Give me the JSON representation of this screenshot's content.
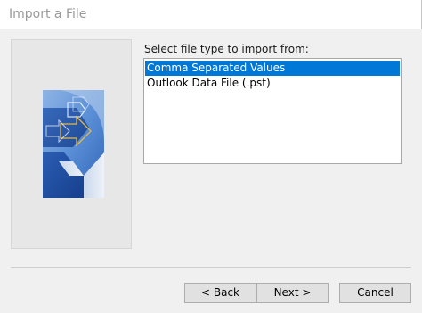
{
  "window": {
    "title": "Import a File"
  },
  "art": {
    "icon": "import-wizard-illustration-icon",
    "colors": {
      "dark_blue": "#1f4fa0",
      "light_blue": "#6f9edc",
      "pale": "#dfe6f1",
      "arrow_outline": "#d9b24a"
    }
  },
  "main": {
    "prompt_label": "Select file type to import from:",
    "file_types": [
      {
        "label": "Comma Separated Values",
        "selected": true
      },
      {
        "label": "Outlook Data File (.pst)",
        "selected": false
      }
    ]
  },
  "buttons": {
    "back_label": "< Back",
    "next_label": "Next >",
    "cancel_label": "Cancel"
  },
  "colors": {
    "selection": "#0078d7",
    "dialog_background": "#f0f0f0",
    "title_text": "#9a9a9a"
  }
}
